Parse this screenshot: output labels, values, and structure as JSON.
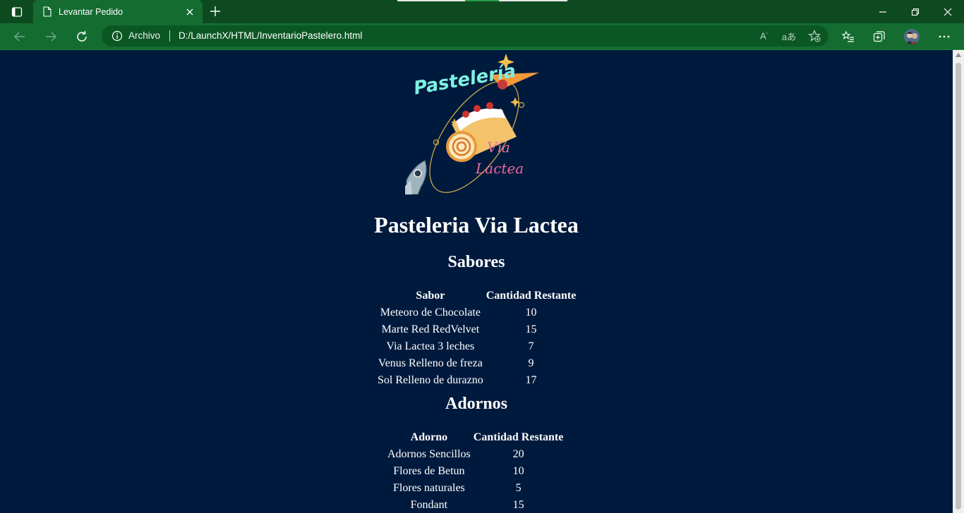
{
  "browser": {
    "tab_title": "Levantar Pedido",
    "site_label": "Archivo",
    "url": "D:/LaunchX/HTML/InventarioPastelero.html",
    "icons": [
      "tab-actions-icon",
      "document-icon",
      "close-icon",
      "plus-icon",
      "minimize-icon",
      "restore-icon",
      "close-window-icon",
      "back-icon",
      "forward-icon",
      "refresh-icon",
      "info-icon",
      "read-aloud-icon",
      "translate-icon",
      "add-favorite-icon",
      "favorites-icon",
      "collections-icon",
      "profile-avatar",
      "more-icon"
    ]
  },
  "page": {
    "logo": {
      "text_line1": "Pastelería",
      "text_line2": "Vía",
      "text_line3": "Láctea"
    },
    "title": "Pasteleria Via Lactea",
    "sabores": {
      "heading": "Sabores",
      "columns": [
        "Sabor",
        "Cantidad Restante"
      ],
      "rows": [
        [
          "Meteoro de Chocolate",
          "10"
        ],
        [
          "Marte Red RedVelvet",
          "15"
        ],
        [
          "Via Lactea 3 leches",
          "7"
        ],
        [
          "Venus Relleno de freza",
          "9"
        ],
        [
          "Sol Relleno de durazno",
          "17"
        ]
      ]
    },
    "adornos": {
      "heading": "Adornos",
      "columns": [
        "Adorno",
        "Cantidad Restante"
      ],
      "rows": [
        [
          "Adornos Sencillos",
          "20"
        ],
        [
          "Flores de Betun",
          "10"
        ],
        [
          "Flores naturales",
          "5"
        ],
        [
          "Fondant",
          "15"
        ]
      ]
    }
  },
  "colors": {
    "page_background": "#001a3d",
    "chrome_dark": "#0e4a1f",
    "chrome_light": "#146c31",
    "logo_cyan": "#7ff0e0",
    "logo_pink": "#e86aa0",
    "logo_orange": "#f29a3a"
  }
}
